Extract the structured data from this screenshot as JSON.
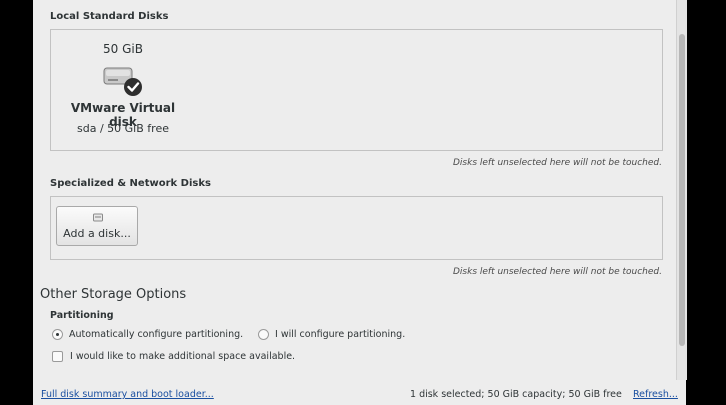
{
  "local": {
    "title": "Local Standard Disks",
    "disk": {
      "size": "50 GiB",
      "name": "VMware Virtual disk",
      "info": "sda  /  50 GiB free",
      "icon": "harddisk-selected-icon"
    },
    "note": "Disks left unselected here will not be touched."
  },
  "specialized": {
    "title": "Specialized & Network Disks",
    "add_button": "Add a disk...",
    "note": "Disks left unselected here will not be touched."
  },
  "other": {
    "title": "Other Storage Options",
    "partitioning_label": "Partitioning",
    "auto_label": "Automatically configure partitioning.",
    "manual_label": "I will configure partitioning.",
    "selected": "auto",
    "extra_space_label": "I would like to make additional space available.",
    "extra_space_checked": false
  },
  "footer": {
    "summary_link": "Full disk summary and boot loader...",
    "status": "1 disk selected; 50 GiB capacity; 50 GiB free",
    "refresh_link": "Refresh..."
  },
  "colors": {
    "background": "#ededed",
    "link": "#1a4fa0",
    "text": "#2e3436"
  }
}
